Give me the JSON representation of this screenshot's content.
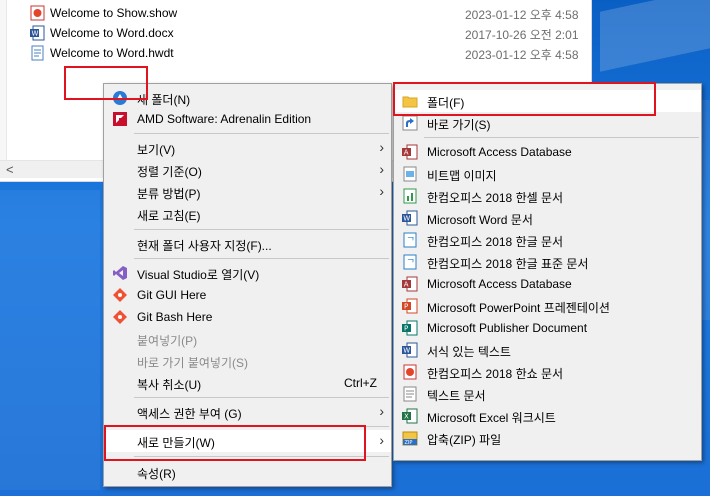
{
  "files": [
    {
      "name": "Welcome to Show.show",
      "date": "2023-01-12 오후 4:58",
      "icon": "hanshow-icon"
    },
    {
      "name": "Welcome to Word.docx",
      "date": "2017-10-26 오전 2:01",
      "icon": "word-doc-icon"
    },
    {
      "name": "Welcome to Word.hwdt",
      "date": "2023-01-12 오후 4:58",
      "icon": "hwdt-doc-icon"
    }
  ],
  "context_menu": {
    "new_folder": "새 폴더(N)",
    "amd": "AMD Software: Adrenalin Edition",
    "view": "보기(V)",
    "sort_by": "정렬 기준(O)",
    "group_by": "분류 방법(P)",
    "refresh": "새로 고침(E)",
    "customize": "현재 폴더 사용자 지정(F)...",
    "open_vs": "Visual Studio로 열기(V)",
    "git_gui": "Git GUI Here",
    "git_bash": "Git Bash Here",
    "paste": "붙여넣기(P)",
    "paste_shortcut": "바로 가기 붙여넣기(S)",
    "undo_copy": "복사 취소(U)",
    "undo_copy_shortcut": "Ctrl+Z",
    "give_access": "액세스 권한 부여 (G)",
    "new": "새로 만들기(W)",
    "properties": "속성(R)"
  },
  "submenu": {
    "folder": "폴더(F)",
    "shortcut": "바로 가기(S)",
    "access_db_1": "Microsoft Access Database",
    "bitmap": "비트맵 이미지",
    "hancell": "한컴오피스 2018 한셀 문서",
    "word_doc": "Microsoft Word 문서",
    "hangul_doc": "한컴오피스 2018 한글 문서",
    "hangul_std_doc": "한컴오피스 2018 한글 표준 문서",
    "access_db_2": "Microsoft Access Database",
    "ppt": "Microsoft PowerPoint 프레젠테이션",
    "publisher": "Microsoft Publisher Document",
    "rtf": "서식 있는 텍스트",
    "hanshow": "한컴오피스 2018 한쇼 문서",
    "text": "텍스트 문서",
    "excel": "Microsoft Excel 워크시트",
    "zip": "압축(ZIP) 파일"
  },
  "colors": {
    "highlight_box": "#e0141e",
    "desktop": "#1b6fd6",
    "menu_bg": "#f0f0f0"
  }
}
